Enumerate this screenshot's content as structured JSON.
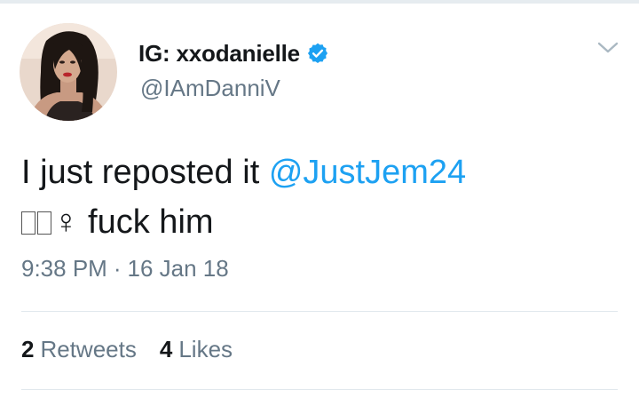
{
  "user": {
    "display_name": "IG: xxodanielle",
    "handle": "@IAmDanniV",
    "verified": true,
    "avatar": "profile-photo"
  },
  "tweet": {
    "text_line1_prefix": "I just reposted it ",
    "mention": "@JustJem24",
    "text_line2_emoji": "♀",
    "text_line2_rest": " fuck him",
    "time": "9:38 PM",
    "separator": "·",
    "date": "16 Jan 18"
  },
  "stats": {
    "retweets_count": "2",
    "retweets_label": "Retweets",
    "likes_count": "4",
    "likes_label": "Likes"
  },
  "icons": {
    "verified": "verified-badge-icon",
    "menu": "chevron-down-icon"
  },
  "colors": {
    "link": "#1da1f2",
    "secondary_text": "#657786",
    "primary_text": "#14171a",
    "divider": "#e1e8ed"
  }
}
